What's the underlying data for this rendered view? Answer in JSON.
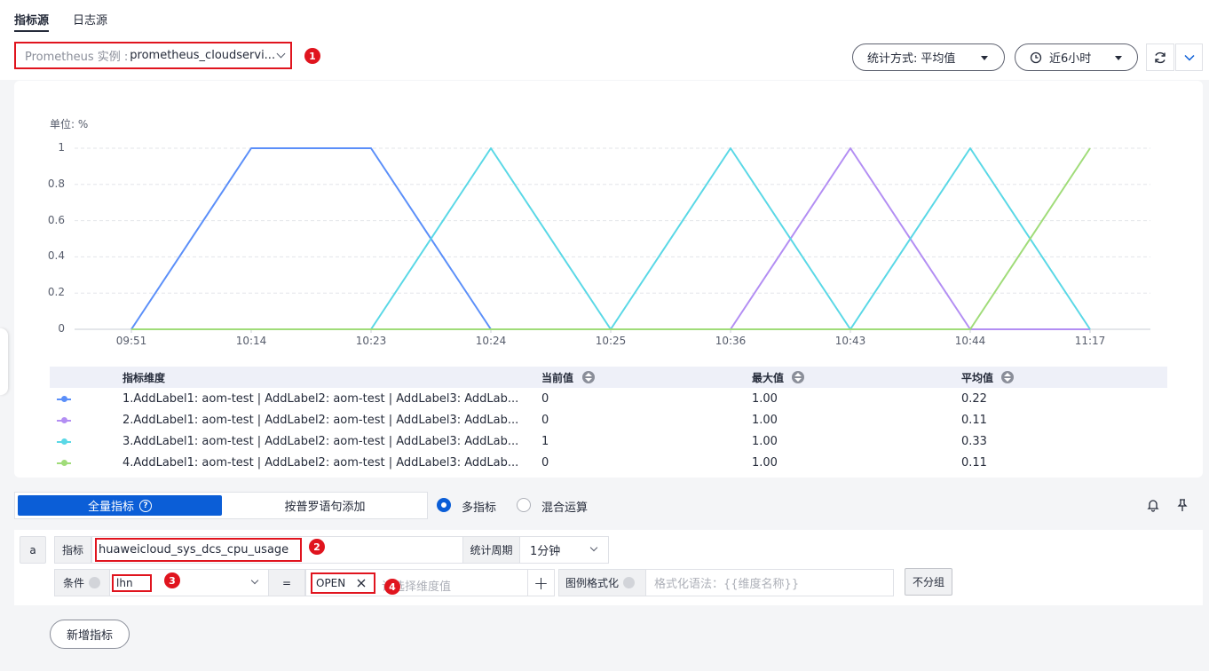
{
  "tabs": [
    {
      "label": "指标源",
      "active": true
    },
    {
      "label": "日志源",
      "active": false
    }
  ],
  "source_select": {
    "label": "Prometheus 实例 :",
    "value": "prometheus_cloudservi..."
  },
  "badges": [
    "1",
    "2",
    "3",
    "4"
  ],
  "stats_method": {
    "label": "统计方式:",
    "value": "平均值"
  },
  "time_range": {
    "value": "近6小时"
  },
  "icons": {
    "refresh": "refresh-icon",
    "expand": "chevron-down-icon",
    "clock": "clock-icon",
    "bell": "bell-icon",
    "pin": "pin-icon"
  },
  "colors": {
    "accent": "#0b5ed7",
    "highlight": "#e0141e",
    "series1": "#5b8ff9",
    "series2": "#b38ef3",
    "series3": "#5ad8e6",
    "series4": "#a0dc79"
  },
  "chart_data": {
    "type": "line",
    "unit_label": "单位: %",
    "x": [
      "09:51",
      "10:14",
      "10:23",
      "10:24",
      "10:25",
      "10:36",
      "10:43",
      "10:44",
      "11:17"
    ],
    "yticks": [
      "0",
      "0.2",
      "0.4",
      "0.6",
      "0.8",
      "1"
    ],
    "ylim": [
      0,
      1
    ],
    "grid": true,
    "series": [
      {
        "name": "1.AddLabel1: aom-test | AddLabel2: aom-test | AddLabel3: AddLab...",
        "color": "#5b8ff9",
        "values": [
          0,
          1,
          1,
          0,
          null,
          null,
          null,
          null,
          null
        ]
      },
      {
        "name": "2.AddLabel1: aom-test | AddLabel2: aom-test | AddLabel3: AddLab...",
        "color": "#b38ef3",
        "values": [
          null,
          null,
          null,
          null,
          null,
          0,
          1,
          0,
          0
        ]
      },
      {
        "name": "3.AddLabel1: aom-test | AddLabel2: aom-test | AddLabel3: AddLab...",
        "color": "#5ad8e6",
        "values": [
          null,
          null,
          0,
          1,
          0,
          1,
          0,
          1,
          0
        ]
      },
      {
        "name": "4.AddLabel1: aom-test | AddLabel2: aom-test | AddLabel3: AddLab...",
        "color": "#a0dc79",
        "values": [
          0,
          0,
          0,
          0,
          0,
          0,
          0,
          0,
          1
        ]
      }
    ]
  },
  "legend": {
    "headers": {
      "dimension": "指标维度",
      "current": "当前值",
      "max": "最大值",
      "avg": "平均值"
    },
    "rows": [
      {
        "name": "1.AddLabel1: aom-test | AddLabel2: aom-test | AddLabel3: AddLab...",
        "current": "0",
        "max": "1.00",
        "avg": "0.22",
        "color": "#5b8ff9"
      },
      {
        "name": "2.AddLabel1: aom-test | AddLabel2: aom-test | AddLabel3: AddLab...",
        "current": "0",
        "max": "1.00",
        "avg": "0.11",
        "color": "#b38ef3"
      },
      {
        "name": "3.AddLabel1: aom-test | AddLabel2: aom-test | AddLabel3: AddLab...",
        "current": "1",
        "max": "1.00",
        "avg": "0.33",
        "color": "#5ad8e6"
      },
      {
        "name": "4.AddLabel1: aom-test | AddLabel2: aom-test | AddLabel3: AddLab...",
        "current": "0",
        "max": "1.00",
        "avg": "0.11",
        "color": "#a0dc79"
      }
    ]
  },
  "mode_tabs": {
    "all": "全量指标",
    "promql": "按普罗语句添加"
  },
  "radios": {
    "multi": "多指标",
    "mixed": "混合运算"
  },
  "query": {
    "row_label": "a",
    "metric_label": "指标",
    "metric_value": "huaweicloud_sys_dcs_cpu_usage",
    "period_label": "统计周期",
    "period_value": "1分钟",
    "condition_label": "条件",
    "condition_key": "lhn",
    "operator": "=",
    "condition_value": "OPEN",
    "value_placeholder": "请选择维度值",
    "add_symbol": "+",
    "legend_format_label": "图例格式化",
    "legend_format_placeholder": "格式化语法：{{维度名称}}",
    "no_group": "不分组"
  },
  "add_metric_button": "新增指标"
}
